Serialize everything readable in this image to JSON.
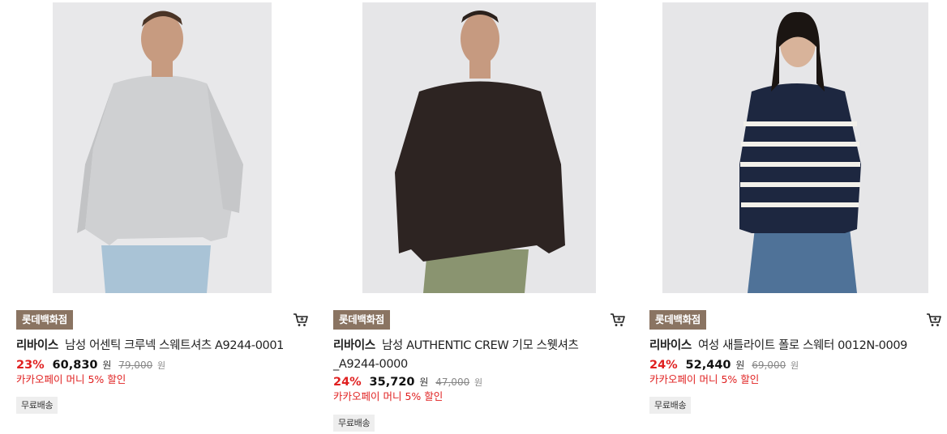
{
  "products": [
    {
      "store": "롯데백화점",
      "brand": "리바이스",
      "name": "남성 어센틱 크루넥 스웨트셔츠 A9244-0001",
      "discount": "23%",
      "price": "60,830",
      "currency": "원",
      "original_price": "79,000",
      "original_currency": "원",
      "promo": "카카오페이 머니 5% 할인",
      "shipping": "무료배송"
    },
    {
      "store": "롯데백화점",
      "brand": "리바이스",
      "name": "남성 AUTHENTIC CREW 기모 스웻셔츠 _A9244-0000",
      "discount": "24%",
      "price": "35,720",
      "currency": "원",
      "original_price": "47,000",
      "original_currency": "원",
      "promo": "카카오페이 머니 5% 할인",
      "shipping": "무료배송"
    },
    {
      "store": "롯데백화점",
      "brand": "리바이스",
      "name": "여성 새틀라이트 폴로 스웨터 0012N-0009",
      "discount": "24%",
      "price": "52,440",
      "currency": "원",
      "original_price": "69,000",
      "original_currency": "원",
      "promo": "카카오페이 머니 5% 할인",
      "shipping": "무료배송"
    }
  ],
  "colors": {
    "store_badge": "#8a7462",
    "discount": "#e02020",
    "image_bg": "#e6e6e8"
  },
  "icons": {
    "cart": "cart-icon"
  }
}
